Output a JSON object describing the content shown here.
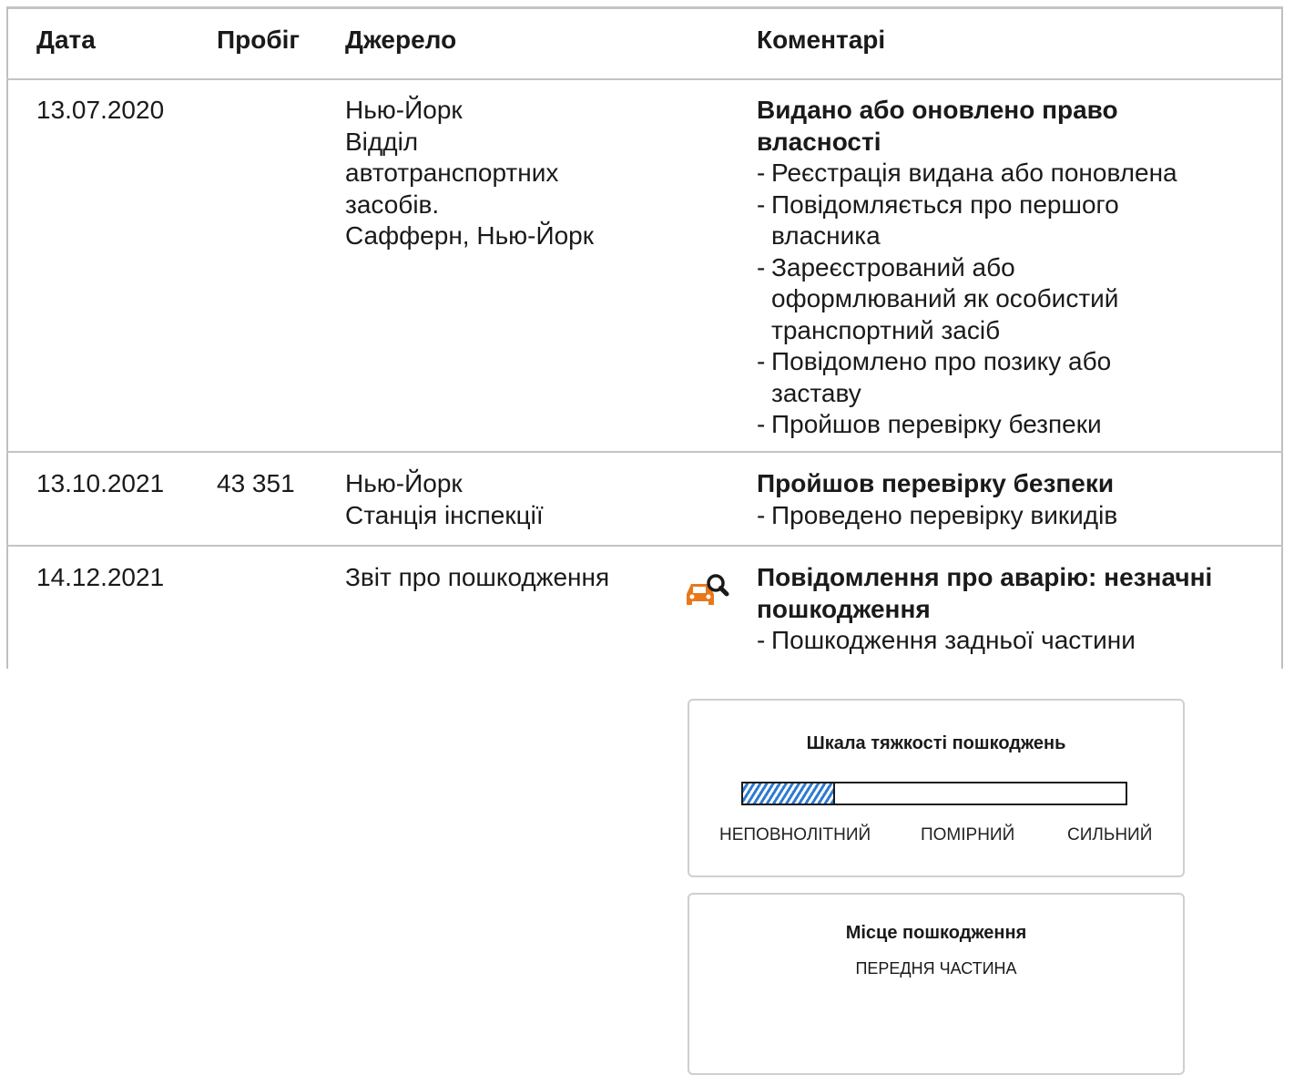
{
  "table": {
    "headers": {
      "date": "Дата",
      "mileage": "Пробіг",
      "source": "Джерело",
      "comments": "Коментарі"
    },
    "rows": [
      {
        "date": "13.07.2020",
        "mileage": "",
        "source_lines": [
          "Нью-Йорк",
          "Відділ",
          "автотранспортних",
          "засобів.",
          "Сафферн, Нью-Йорк"
        ],
        "comment_title_lines": [
          "Видано або оновлено право",
          "власності"
        ],
        "comment_items": [
          [
            "Реєстрація видана або поновлена"
          ],
          [
            "Повідомляється про першого",
            "власника"
          ],
          [
            "Зареєстрований або",
            "оформлюваний як особистий",
            "транспортний засіб"
          ],
          [
            "Повідомлено про позику або",
            "заставу"
          ],
          [
            "Пройшов перевірку безпеки"
          ]
        ]
      },
      {
        "date": "13.10.2021",
        "mileage": "43 351",
        "source_lines": [
          "Нью-Йорк",
          "Станція інспекції"
        ],
        "comment_title_lines": [
          "Пройшов перевірку безпеки"
        ],
        "comment_items": [
          [
            "Проведено перевірку викидів"
          ]
        ]
      },
      {
        "date": "14.12.2021",
        "mileage": "",
        "source_lines": [
          "Звіт про пошкодження"
        ],
        "icon": "car-damage-search-icon",
        "icon_color": "#e8781c",
        "comment_title_lines": [
          "Повідомлення про аварію: незначні",
          "пошкодження"
        ],
        "comment_items": [
          [
            "Пошкодження задньої частини"
          ]
        ]
      }
    ]
  },
  "severity_panel": {
    "title": "Шкала тяжкості пошкоджень",
    "labels": [
      "НЕПОВНОЛІТНИЙ",
      "ПОМІРНИЙ",
      "СИЛЬНИЙ"
    ],
    "level_fraction": 0.24,
    "fill_color": "#2f7ad1"
  },
  "location_panel": {
    "title": "Місце пошкодження",
    "value": "ПЕРЕДНЯ ЧАСТИНА"
  }
}
